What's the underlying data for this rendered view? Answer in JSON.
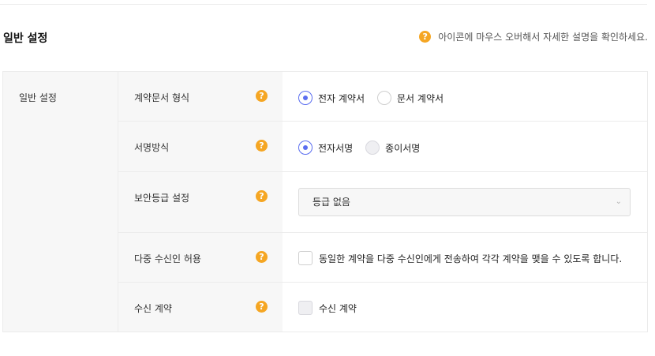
{
  "page": {
    "section_title": "일반 설정",
    "hint_text": "아이콘에 마우스 오버해서 자세한 설명을 확인하세요.",
    "help_glyph": "?"
  },
  "settings": {
    "group_label": "일반 설정",
    "contract_format": {
      "label": "계약문서 형식",
      "options": [
        "전자 계약서",
        "문서 계약서"
      ],
      "selected": "전자 계약서"
    },
    "signature_method": {
      "label": "서명방식",
      "options": [
        "전자서명",
        "종이서명"
      ],
      "selected": "전자서명"
    },
    "security_level": {
      "label": "보안등급 설정",
      "value": "등급 없음"
    },
    "multi_recipient": {
      "label": "다중 수신인 허용",
      "checkbox_text": "동일한 계약을 다중 수신인에게 전송하여 각각 계약을 맺을 수 있도록 합니다.",
      "checked": false
    },
    "receive_contract": {
      "label": "수신 계약",
      "checkbox_text": "수신 계약",
      "checked": false
    }
  },
  "colors": {
    "accent": "#5b6ef0",
    "help_icon": "#f5a623",
    "label_bg": "#f7f7f7"
  },
  "icons": [
    "help-icon",
    "chevron-down-icon"
  ]
}
